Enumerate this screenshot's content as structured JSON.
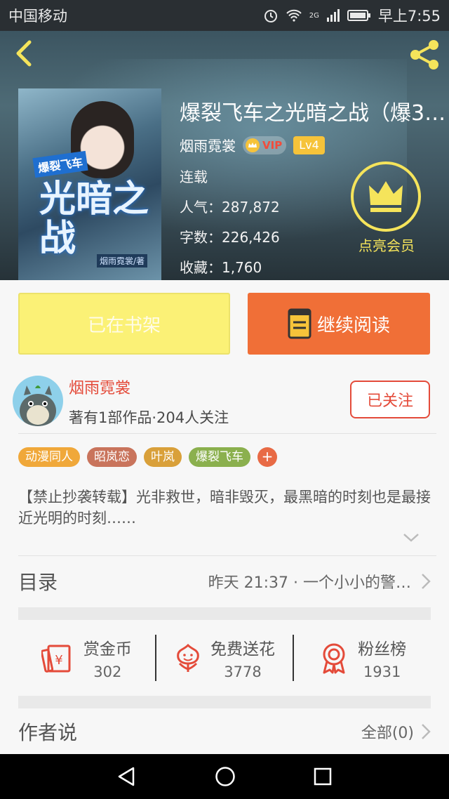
{
  "status_bar": {
    "carrier": "中国移动",
    "network": "2G",
    "time": "早上7:55"
  },
  "book": {
    "cover_tag": "爆裂飞车",
    "cover_title": "光暗之战",
    "cover_author": "烟雨霓裳/著",
    "title": "爆裂飞车之光暗之战（爆3…",
    "author": "烟雨霓裳",
    "vip_label": "VIP",
    "level": "Lv4",
    "status": "连载",
    "popularity": "人气：287,872",
    "word_count": "字数：226,426",
    "favorites": "收藏：1,760"
  },
  "member": {
    "label": "点亮会员"
  },
  "buttons": {
    "shelf": "已在书架",
    "read": "继续阅读",
    "follow": "已关注"
  },
  "author_card": {
    "name": "烟雨霓裳",
    "stats": "著有1部作品·204人关注"
  },
  "tags": [
    {
      "label": "动漫同人",
      "color": "#f0a83a"
    },
    {
      "label": "昭岚恋",
      "color": "#c9745c"
    },
    {
      "label": "叶岚",
      "color": "#d9a03a"
    },
    {
      "label": "爆裂飞车",
      "color": "#8bb04e"
    }
  ],
  "tag_add": "+",
  "description": "【禁止抄袭转载】光非救世，暗非毁灭，最黑暗的时刻也是最接近光明的时刻……",
  "toc": {
    "label": "目录",
    "latest": "昨天 21:37 · 一个小小的警…"
  },
  "actions": [
    {
      "icon": "reward-coin-icon",
      "label": "赏金币",
      "count": "302"
    },
    {
      "icon": "flower-icon",
      "label": "免费送花",
      "count": "3778"
    },
    {
      "icon": "medal-icon",
      "label": "粉丝榜",
      "count": "1931"
    }
  ],
  "author_say": {
    "label": "作者说",
    "all": "全部(0)"
  },
  "colors": {
    "accent": "#f06f37",
    "red": "#e44b3a",
    "yellow": "#fbf176",
    "member": "#f5e45b"
  }
}
